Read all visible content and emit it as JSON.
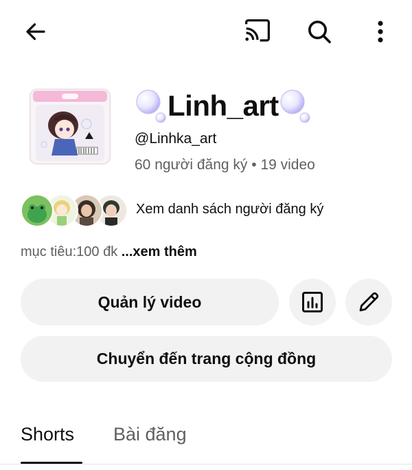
{
  "topbar": {
    "back_icon": "back-arrow-icon",
    "cast_icon": "cast-icon",
    "search_icon": "search-icon",
    "more_icon": "more-vert-icon"
  },
  "channel": {
    "name": "Linh_art",
    "handle": "@Linhka_art",
    "stats": "60 người đăng ký • 19 video"
  },
  "subscribers": {
    "link_label": "Xem danh sách người đăng ký"
  },
  "description": {
    "text": "mục tiêu:100 đk ",
    "more_label": "...xem thêm"
  },
  "actions": {
    "manage_videos": "Quản lý video",
    "community": "Chuyển đến trang cộng đồng",
    "analytics_icon": "analytics-icon",
    "edit_icon": "edit-pencil-icon"
  },
  "tabs": [
    {
      "label": "Shorts",
      "active": true
    },
    {
      "label": "Bài đăng",
      "active": false
    }
  ],
  "colors": {
    "text_primary": "#0f0f0f",
    "text_secondary": "#606060",
    "button_bg": "#f2f2f2"
  }
}
